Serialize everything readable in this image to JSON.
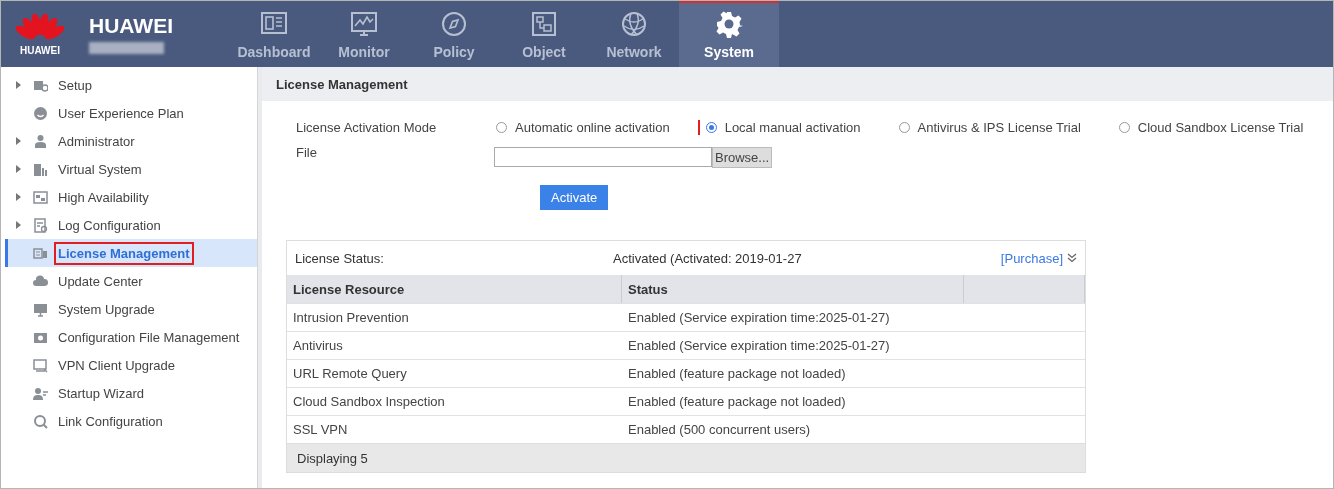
{
  "header": {
    "logo_text": "HUAWEI",
    "brand": "HUAWEI"
  },
  "nav": [
    {
      "label": "Dashboard",
      "selected": false
    },
    {
      "label": "Monitor",
      "selected": false
    },
    {
      "label": "Policy",
      "selected": false
    },
    {
      "label": "Object",
      "selected": false
    },
    {
      "label": "Network",
      "selected": false
    },
    {
      "label": "System",
      "selected": true
    }
  ],
  "sidebar": {
    "items": [
      {
        "label": "Setup",
        "kind": "folder",
        "selected": false
      },
      {
        "label": "User Experience Plan",
        "kind": "page",
        "selected": false
      },
      {
        "label": "Administrator",
        "kind": "folder",
        "selected": false
      },
      {
        "label": "Virtual System",
        "kind": "folder",
        "selected": false
      },
      {
        "label": "High Availability",
        "kind": "folder",
        "selected": false
      },
      {
        "label": "Log Configuration",
        "kind": "folder",
        "selected": false
      },
      {
        "label": "License Management",
        "kind": "page",
        "selected": true
      },
      {
        "label": "Update Center",
        "kind": "page",
        "selected": false
      },
      {
        "label": "System Upgrade",
        "kind": "page",
        "selected": false
      },
      {
        "label": "Configuration File Management",
        "kind": "page",
        "selected": false
      },
      {
        "label": "VPN Client Upgrade",
        "kind": "page",
        "selected": false
      },
      {
        "label": "Startup Wizard",
        "kind": "page",
        "selected": false
      },
      {
        "label": "Link Configuration",
        "kind": "page",
        "selected": false
      }
    ]
  },
  "page_title": "License Management",
  "form": {
    "mode_label": "License Activation Mode",
    "modes": [
      {
        "label": "Automatic online activation",
        "selected": false
      },
      {
        "label": "Local manual activation",
        "selected": true
      },
      {
        "label": "Antivirus & IPS License Trial",
        "selected": false
      },
      {
        "label": "Cloud Sandbox License Trial",
        "selected": false
      }
    ],
    "file_label": "File",
    "browse": "Browse...",
    "activate": "Activate"
  },
  "license_status": {
    "label": "License Status:",
    "value": "Activated (Activated:  2019-01-27",
    "purchase": "[Purchase]"
  },
  "table": {
    "columns": [
      "License Resource",
      "Status"
    ],
    "rows": [
      [
        "Intrusion Prevention",
        "Enabled (Service expiration time:2025-01-27)"
      ],
      [
        "Antivirus",
        "Enabled (Service expiration time:2025-01-27)"
      ],
      [
        "URL Remote Query",
        "Enabled (feature package not loaded)"
      ],
      [
        "Cloud Sandbox Inspection",
        "Enabled (feature package not loaded)"
      ],
      [
        "SSL VPN",
        "Enabled  (500 concurrent users)"
      ]
    ],
    "footer": "Displaying 5"
  }
}
